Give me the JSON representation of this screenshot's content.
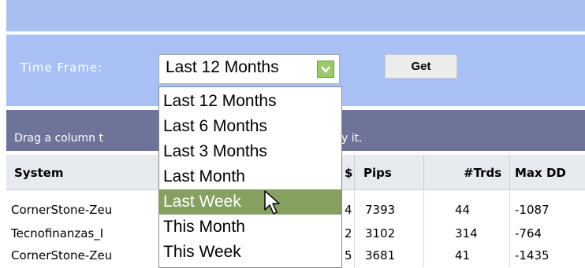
{
  "filter": {
    "label": "Time Frame:",
    "selected": "Last 12 Months",
    "get_label": "Get",
    "options": [
      "Last 12 Months",
      "Last 6 Months",
      "Last 3 Months",
      "Last Month",
      "Last Week",
      "This Month",
      "This Week"
    ],
    "highlighted_option": "Last Week"
  },
  "grid": {
    "group_hint_start": "Drag a column t",
    "group_hint_end": "y it.",
    "columns": [
      "System",
      "$",
      "Pips",
      "#Trds",
      "Max DD"
    ],
    "rows": [
      {
        "system": "CornerStone-Zeu",
        "dollar": "4",
        "pips": "7393",
        "trades": "44",
        "max_dd": "-1087"
      },
      {
        "system": "Tecnofinanzas_I",
        "dollar": "2",
        "pips": "3102",
        "trades": "314",
        "max_dd": "-764"
      },
      {
        "system": "CornerStone-Zeu",
        "dollar": "5",
        "pips": "3681",
        "trades": "41",
        "max_dd": "-1435"
      }
    ]
  },
  "colors": {
    "filter_bar": "#a9c0f4",
    "group_bar": "#6d7399",
    "dropdown_highlight": "#86a061",
    "dropdown_arrow": "#9bc86b"
  },
  "icons": {
    "select_arrow": "chevron-down-icon",
    "cursor": "mouse-pointer-icon"
  }
}
